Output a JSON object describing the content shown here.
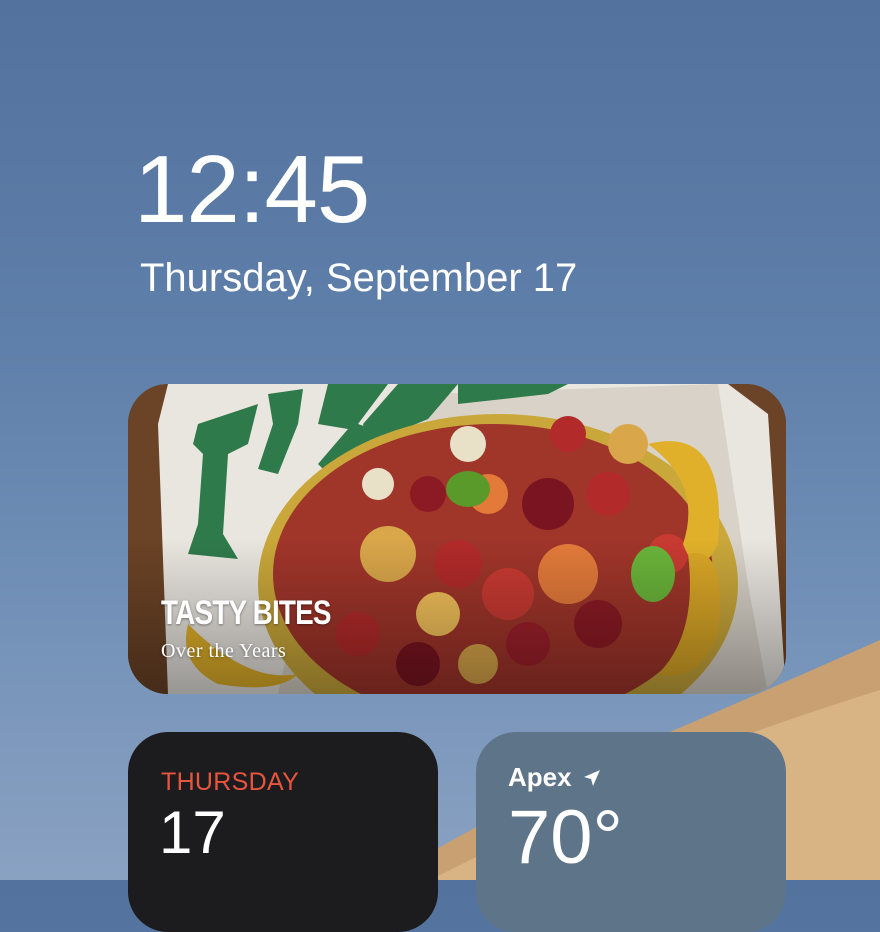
{
  "lock_screen": {
    "time": "12:45",
    "date": "Thursday, September 17"
  },
  "photo_widget": {
    "title": "TASTY BITES",
    "subtitle": "Over the Years",
    "image_description_icon": "photo"
  },
  "calendar_widget": {
    "weekday": "THURSDAY",
    "day": "17",
    "weekday_color": "#e8553f"
  },
  "weather_widget": {
    "location": "Apex",
    "temperature": "70°",
    "location_icon": "location-arrow-icon"
  }
}
